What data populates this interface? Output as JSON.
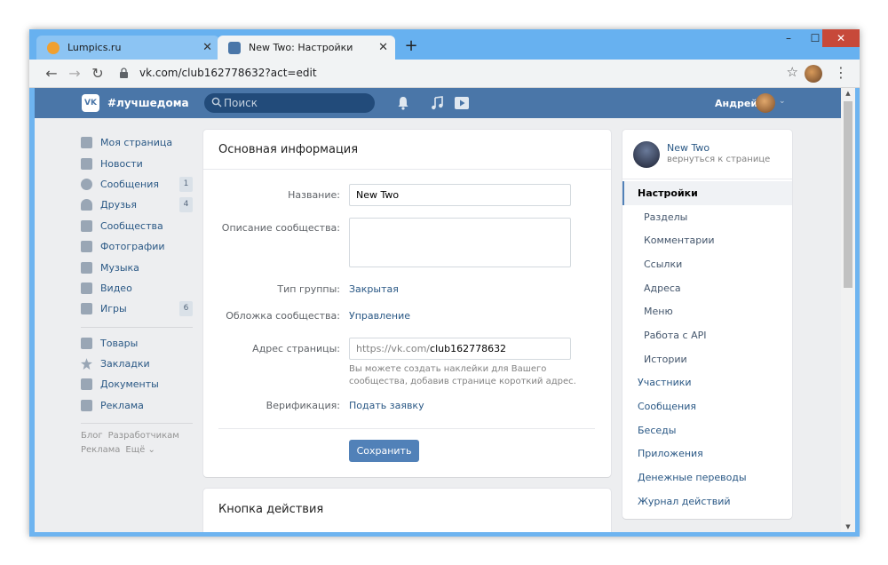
{
  "browser": {
    "tabs": [
      {
        "title": "Lumpics.ru",
        "active": false,
        "favicon_color": "#f0a030"
      },
      {
        "title": "New Two: Настройки",
        "active": true,
        "favicon_color": "#4a76a8"
      }
    ],
    "new_tab_label": "+",
    "url": "vk.com/club162778632?act=edit",
    "controls": {
      "minimize": "–",
      "maximize": "☐",
      "close": "✕"
    }
  },
  "vk": {
    "site_name": "#лучшедома",
    "search_placeholder": "Поиск",
    "user_name": "Андрей",
    "header_color": "#4a76a8"
  },
  "left_nav": {
    "items": [
      {
        "label": "Моя страница",
        "icon": "home-icon",
        "badge": ""
      },
      {
        "label": "Новости",
        "icon": "news-icon",
        "badge": ""
      },
      {
        "label": "Сообщения",
        "icon": "messages-icon",
        "badge": "1"
      },
      {
        "label": "Друзья",
        "icon": "friends-icon",
        "badge": "4"
      },
      {
        "label": "Сообщества",
        "icon": "communities-icon",
        "badge": ""
      },
      {
        "label": "Фотографии",
        "icon": "photos-icon",
        "badge": ""
      },
      {
        "label": "Музыка",
        "icon": "music-icon",
        "badge": ""
      },
      {
        "label": "Видео",
        "icon": "video-icon",
        "badge": ""
      },
      {
        "label": "Игры",
        "icon": "games-icon",
        "badge": "6"
      }
    ],
    "items2": [
      {
        "label": "Товары",
        "icon": "shopping-bag-icon"
      },
      {
        "label": "Закладки",
        "icon": "star-icon"
      },
      {
        "label": "Документы",
        "icon": "document-icon"
      },
      {
        "label": "Реклама",
        "icon": "megaphone-icon"
      }
    ],
    "footer": {
      "blog": "Блог",
      "developers": "Разработчикам",
      "ads": "Реклама",
      "more": "Ещё ⌄"
    }
  },
  "main": {
    "title": "Основная информация",
    "fields": {
      "name_label": "Название:",
      "name_value": "New Two",
      "description_label": "Описание сообщества:",
      "description_value": "",
      "group_type_label": "Тип группы:",
      "group_type_value": "Закрытая",
      "cover_label": "Обложка сообщества:",
      "cover_value": "Управление",
      "address_label": "Адрес страницы:",
      "address_prefix": "https://vk.com/",
      "address_value": "club162778632",
      "address_hint": "Вы можете создать наклейки для Вашего сообщества, добавив странице короткий адрес.",
      "verification_label": "Верификация:",
      "verification_value": "Подать заявку"
    },
    "save_label": "Сохранить",
    "action_title": "Кнопка действия"
  },
  "right_menu": {
    "group_name": "New Two",
    "back_label": "вернуться к странице",
    "items": [
      {
        "label": "Настройки",
        "type": "active"
      },
      {
        "label": "Разделы",
        "type": "sub"
      },
      {
        "label": "Комментарии",
        "type": "sub"
      },
      {
        "label": "Ссылки",
        "type": "sub"
      },
      {
        "label": "Адреса",
        "type": "sub"
      },
      {
        "label": "Меню",
        "type": "sub"
      },
      {
        "label": "Работа с API",
        "type": "sub"
      },
      {
        "label": "Истории",
        "type": "sub"
      },
      {
        "label": "Участники",
        "type": "main"
      },
      {
        "label": "Сообщения",
        "type": "main"
      },
      {
        "label": "Беседы",
        "type": "main"
      },
      {
        "label": "Приложения",
        "type": "main"
      },
      {
        "label": "Денежные переводы",
        "type": "main"
      },
      {
        "label": "Журнал действий",
        "type": "main"
      }
    ]
  }
}
